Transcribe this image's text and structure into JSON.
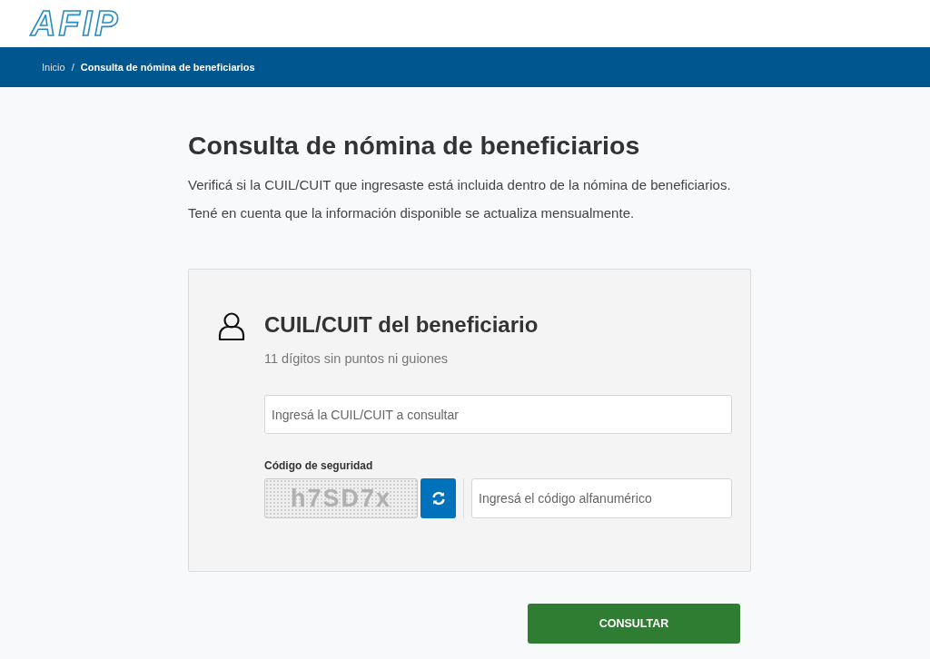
{
  "header": {
    "logo": "AFIP"
  },
  "breadcrumb": {
    "separator": "/",
    "items": [
      {
        "label": "Inicio",
        "current": false
      },
      {
        "label": "Consulta de nómina de beneficiarios",
        "current": true
      }
    ]
  },
  "page": {
    "title": "Consulta de nómina de beneficiarios",
    "paragraphs": [
      "Verificá si la CUIL/CUIT que ingresaste está incluida dentro de la nómina de beneficiarios.",
      "Tené en cuenta que la información disponible se actualiza mensualmente."
    ]
  },
  "form": {
    "heading": "CUIL/CUIT del beneficiario",
    "hint": "11 dígitos sin puntos ni guiones",
    "cuil_field": {
      "placeholder": "Ingresá la CUIL/CUIT a consultar"
    },
    "captcha": {
      "label": "Código de seguridad",
      "code": "h7SD7x",
      "field": {
        "placeholder": "Ingresá el código alfanumérico"
      }
    }
  },
  "submit_button": "CONSULTAR"
}
